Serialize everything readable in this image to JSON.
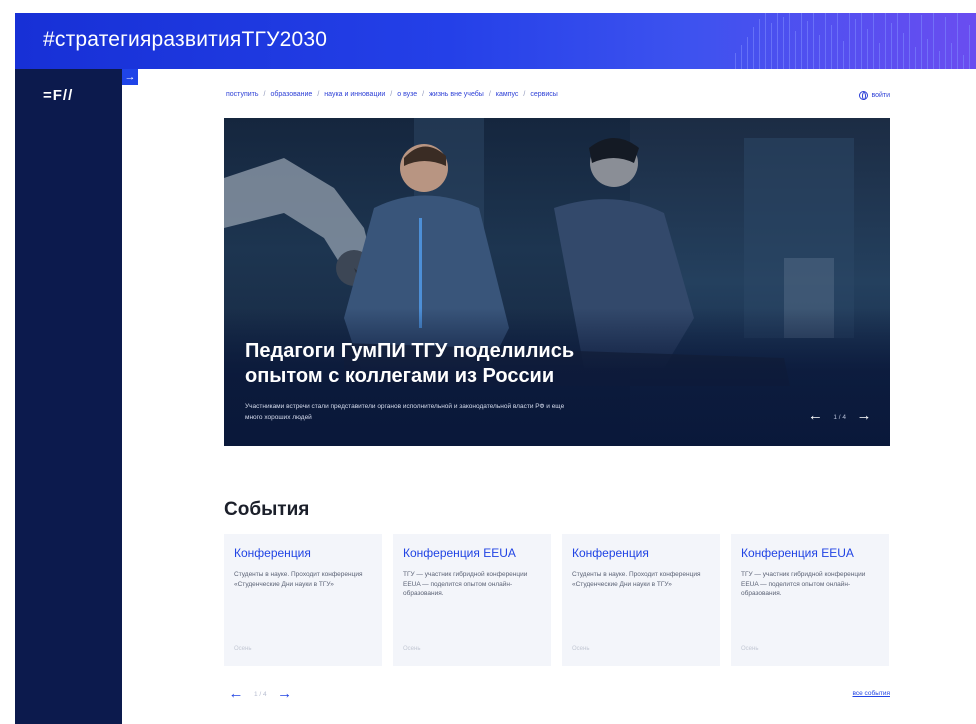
{
  "banner": {
    "title": "#стратегияразвитияТГУ2030"
  },
  "sidebar": {
    "logo": "=F//",
    "toggle_label": "→"
  },
  "nav": {
    "items": [
      "поступить",
      "образование",
      "наука и инновации",
      "о вузе",
      "жизнь вне учебы",
      "кампус",
      "сервисы"
    ],
    "separator": "/",
    "login_label": "войти"
  },
  "hero": {
    "title": "Педагоги ГумПИ ТГУ поделились опытом с коллегами из России",
    "description": "Участниками встречи стали представители органов исполнительной и законодательной власти РФ и еще много хороших людей",
    "counter": "1 / 4",
    "prev_label": "←",
    "next_label": "→"
  },
  "events": {
    "title": "События",
    "cards": [
      {
        "title": "Конференция",
        "text": "Студенты в науке. Проходит конференция «Студенческие Дни науки в ТГУ»",
        "date": "Осень"
      },
      {
        "title": "Конференция EEUA",
        "text": "ТГУ — участник гибридной конференции EEUA — поделится опытом онлайн-образования.",
        "date": "Осень"
      },
      {
        "title": "Конференция",
        "text": "Студенты в науке. Проходит конференция «Студенческие Дни науки в ТГУ»",
        "date": "Осень"
      },
      {
        "title": "Конференция EEUA",
        "text": "ТГУ — участник гибридной конференции EEUA — поделится опытом онлайн-образования.",
        "date": "Осень"
      }
    ],
    "counter": "1 / 4",
    "prev_label": "←",
    "next_label": "→",
    "all_label": "все события"
  },
  "colors": {
    "accent": "#2144e4",
    "sidebar": "#0c1a4d",
    "banner_start": "#1730d6",
    "banner_end": "#6a4df0"
  }
}
